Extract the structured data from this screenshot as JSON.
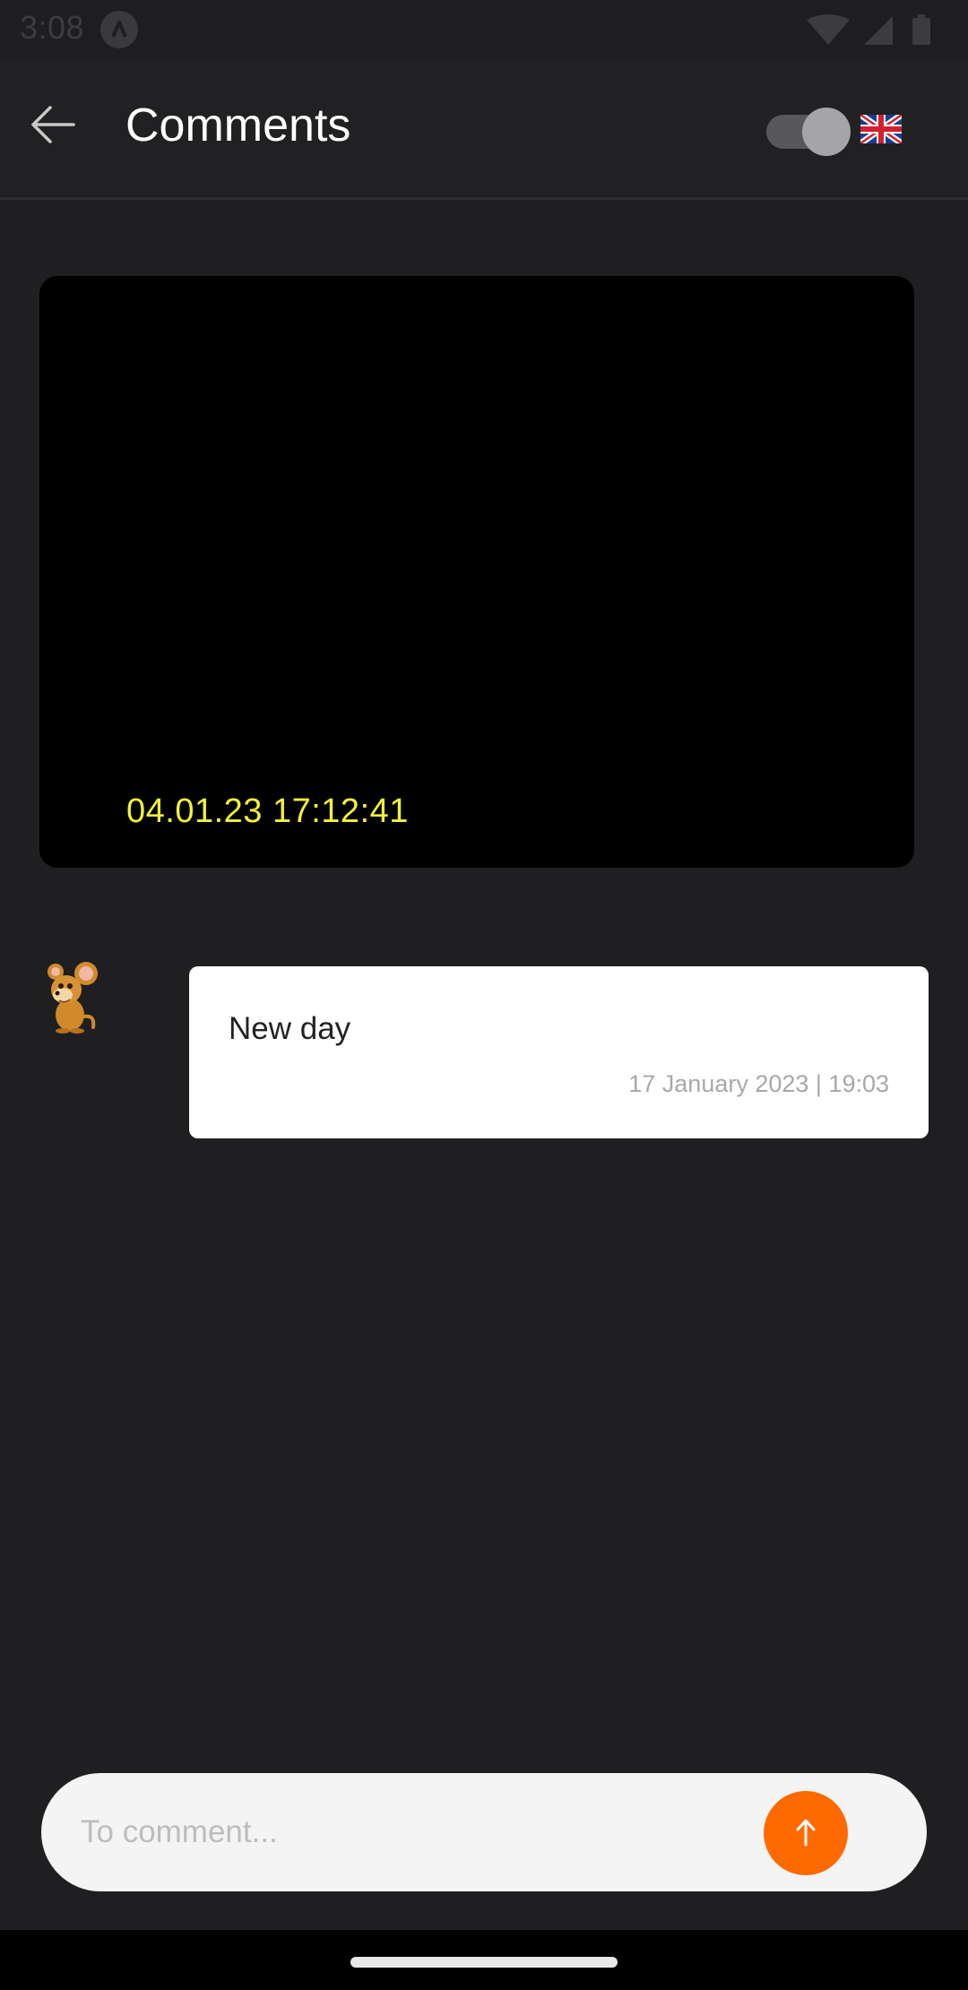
{
  "status_bar": {
    "time": "3:08",
    "icons": [
      "app-notification-icon",
      "wifi-icon",
      "signal-icon",
      "battery-icon"
    ]
  },
  "header": {
    "title": "Comments",
    "back_icon": "arrow-left-icon",
    "toggle_on": true,
    "language_flag": "uk-flag-icon"
  },
  "video": {
    "timestamp": "04.01.23 17:12:41"
  },
  "comments": [
    {
      "avatar": "jerry-mouse-avatar",
      "text": "New day",
      "time": "17 January 2023 | 19:03"
    }
  ],
  "composer": {
    "placeholder": "To comment...",
    "value": "",
    "send_icon": "arrow-up-icon"
  },
  "colors": {
    "background": "#1f1f21",
    "accent": "#ff6a00",
    "timestamp": "#f2f23a",
    "bubble": "#ffffff"
  }
}
